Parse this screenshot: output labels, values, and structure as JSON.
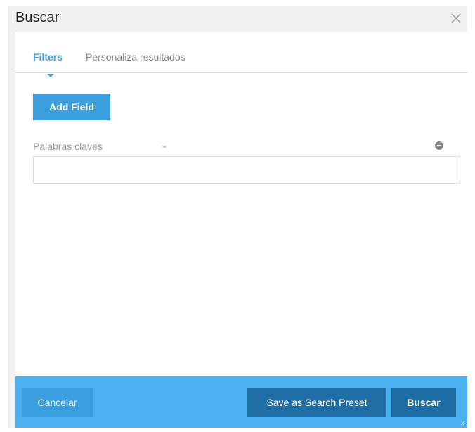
{
  "dialog": {
    "title": "Buscar",
    "close_icon": "close-icon"
  },
  "tabs": [
    {
      "label": "Filters",
      "active": true
    },
    {
      "label": "Personaliza resultados",
      "active": false
    }
  ],
  "filters": {
    "add_field_label": "Add Field",
    "fields": [
      {
        "label": "Palabras claves",
        "value": "",
        "placeholder": ""
      }
    ]
  },
  "footer": {
    "cancel_label": "Cancelar",
    "save_preset_label": "Save as Search Preset",
    "search_label": "Buscar"
  },
  "colors": {
    "accent": "#3ba1d8",
    "footer_bg": "#4bb0f0",
    "primary_button": "#1e6da4"
  }
}
